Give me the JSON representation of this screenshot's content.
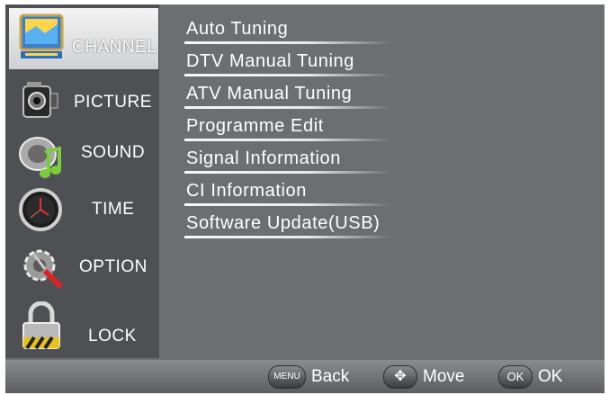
{
  "sidebar": {
    "items": [
      {
        "label": "CHANNEL",
        "icon": "channel-monitor-icon",
        "selected": true
      },
      {
        "label": "PICTURE",
        "icon": "camcorder-icon",
        "selected": false
      },
      {
        "label": "SOUND",
        "icon": "speaker-music-icon",
        "selected": false
      },
      {
        "label": "TIME",
        "icon": "clock-icon",
        "selected": false
      },
      {
        "label": "OPTION",
        "icon": "gear-tool-icon",
        "selected": false
      },
      {
        "label": "LOCK",
        "icon": "padlock-icon",
        "selected": false
      }
    ]
  },
  "menu": {
    "items": [
      {
        "label": "Auto Tuning"
      },
      {
        "label": "DTV Manual Tuning"
      },
      {
        "label": "ATV Manual Tuning"
      },
      {
        "label": "Programme Edit"
      },
      {
        "label": "Signal Information"
      },
      {
        "label": "CI Information"
      },
      {
        "label": "Software Update(USB)"
      }
    ]
  },
  "footer": {
    "back": {
      "key": "MENU",
      "label": "Back",
      "icon": "menu-key-icon"
    },
    "move": {
      "key": "✥",
      "label": "Move",
      "icon": "arrows-move-icon"
    },
    "ok": {
      "key": "OK",
      "label": "OK",
      "icon": "ok-key-icon"
    }
  },
  "colors": {
    "background": "#6d6e71",
    "sidebar": "#4f5053",
    "selected": "#e8e8ea",
    "text": "#ffffff"
  }
}
